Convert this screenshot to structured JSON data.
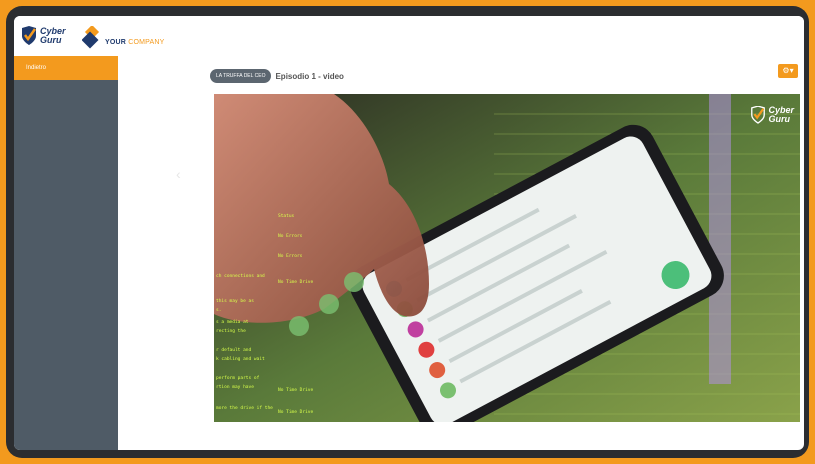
{
  "brand": {
    "cyber_logo_line1": "Cyber",
    "cyber_logo_line2": "Guru",
    "company_logo_bold": "YOUR",
    "company_logo_rest": "COMPANY"
  },
  "sidebar": {
    "items": [
      {
        "label": "Indietro"
      }
    ]
  },
  "main": {
    "category_pill": "LA TRUFFA DEL CEO",
    "title": "Episodio 1 - video",
    "settings_button_icon": "gear-icon",
    "video": {
      "watermark_line1": "Cyber",
      "watermark_line2": "Guru",
      "code_lines": [
        "Status",
        "No Errors",
        "No Errors",
        "ch connections and",
        "No Time Drive",
        "this may be as",
        "s.",
        "s a media at",
        "recting the",
        "r default and",
        "k cabling and wait",
        "perform parts of",
        "rtion may have",
        "No Time Drive",
        "more the drive if the",
        "No Time Drive"
      ]
    }
  },
  "colors": {
    "accent": "#f39a1e",
    "sidebar_bg": "#4f5b66",
    "frame": "#2b2d30",
    "brand_navy": "#1f3a6d"
  }
}
